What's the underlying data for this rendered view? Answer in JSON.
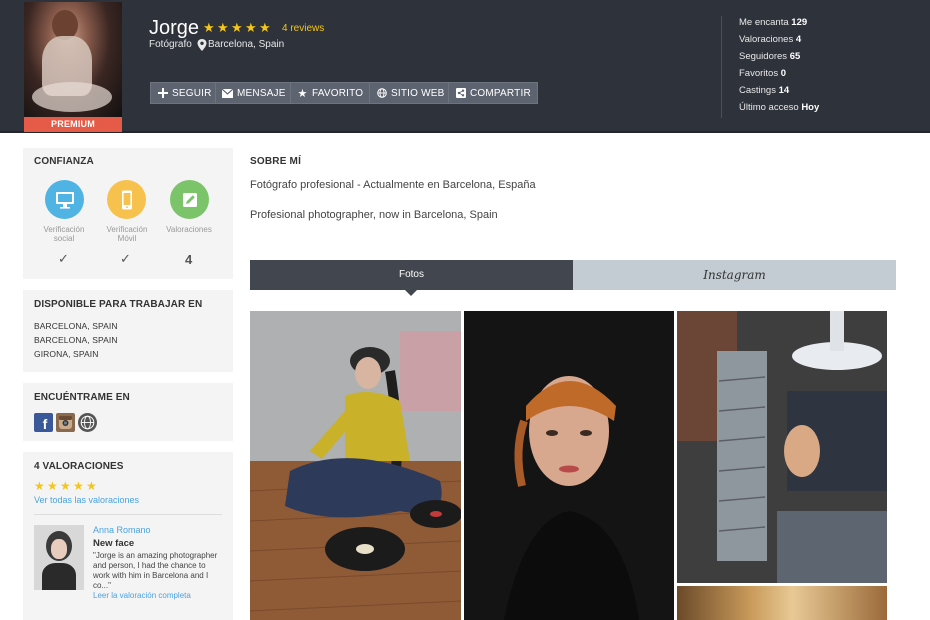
{
  "profile": {
    "name": "Jorge",
    "reviews_link": "4 reviews",
    "rating_stars": 5,
    "role": "Fotógrafo",
    "location": "Barcelona, Spain",
    "badge": "PREMIUM"
  },
  "actions": [
    {
      "label": "SEGUIR",
      "icon": "plus-icon"
    },
    {
      "label": "MENSAJE",
      "icon": "envelope-icon"
    },
    {
      "label": "FAVORITO",
      "icon": "star-icon"
    },
    {
      "label": "SITIO WEB",
      "icon": "globe-icon"
    },
    {
      "label": "COMPARTIR",
      "icon": "share-icon"
    }
  ],
  "stats": [
    {
      "label": "Me encanta",
      "value": "129"
    },
    {
      "label": "Valoraciones",
      "value": "4"
    },
    {
      "label": "Seguidores",
      "value": "65"
    },
    {
      "label": "Favoritos",
      "value": "0"
    },
    {
      "label": "Castings",
      "value": "14"
    },
    {
      "label": "Último acceso",
      "value": "Hoy"
    }
  ],
  "trust": {
    "title": "CONFIANZA",
    "items": [
      {
        "label_line1": "Verificación",
        "label_line2": "social",
        "status": "✓",
        "icon": "monitor-icon",
        "color": "#4fb3e3"
      },
      {
        "label_line1": "Verificación",
        "label_line2": "Móvil",
        "status": "✓",
        "icon": "mobile-icon",
        "color": "#f7c14e"
      },
      {
        "label_line1": "Valoraciones",
        "label_line2": "",
        "status": "4",
        "icon": "pencil-icon",
        "color": "#7cc46a"
      }
    ]
  },
  "availability": {
    "title": "DISPONIBLE PARA TRABAJAR EN",
    "locations": [
      "BARCELONA, SPAIN",
      "BARCELONA, SPAIN",
      "GIRONA, SPAIN"
    ]
  },
  "find_me": {
    "title": "ENCUÉNTRAME EN",
    "networks": [
      {
        "icon": "facebook-icon",
        "color": "#3b5998"
      },
      {
        "icon": "instagram-icon",
        "color": "#8a6a4f"
      },
      {
        "icon": "globe-icon",
        "color": "#555555"
      }
    ]
  },
  "ratings": {
    "title": "4 VALORACIONES",
    "stars": 5,
    "see_all": "Ver todas las valoraciones",
    "review": {
      "author": "Anna Romano",
      "title": "New face",
      "text": "\"Jorge is an amazing photographer and person, I had the chance to work with him in Barcelona and I co...\"",
      "more": "Leer la valoración completa"
    }
  },
  "about": {
    "title": "SOBRE MÍ",
    "line1": "Fotógrafo profesional - Actualmente en Barcelona, España",
    "line2": "Profesional photographer, now in Barcelona, Spain"
  },
  "tabs": {
    "photos": "Fotos",
    "instagram": "Instagram"
  },
  "colors": {
    "header_bg": "#2e323b",
    "premium": "#e55b47",
    "star": "#f5c518",
    "link": "#4aa3df",
    "button_bg": "#5d6470"
  }
}
